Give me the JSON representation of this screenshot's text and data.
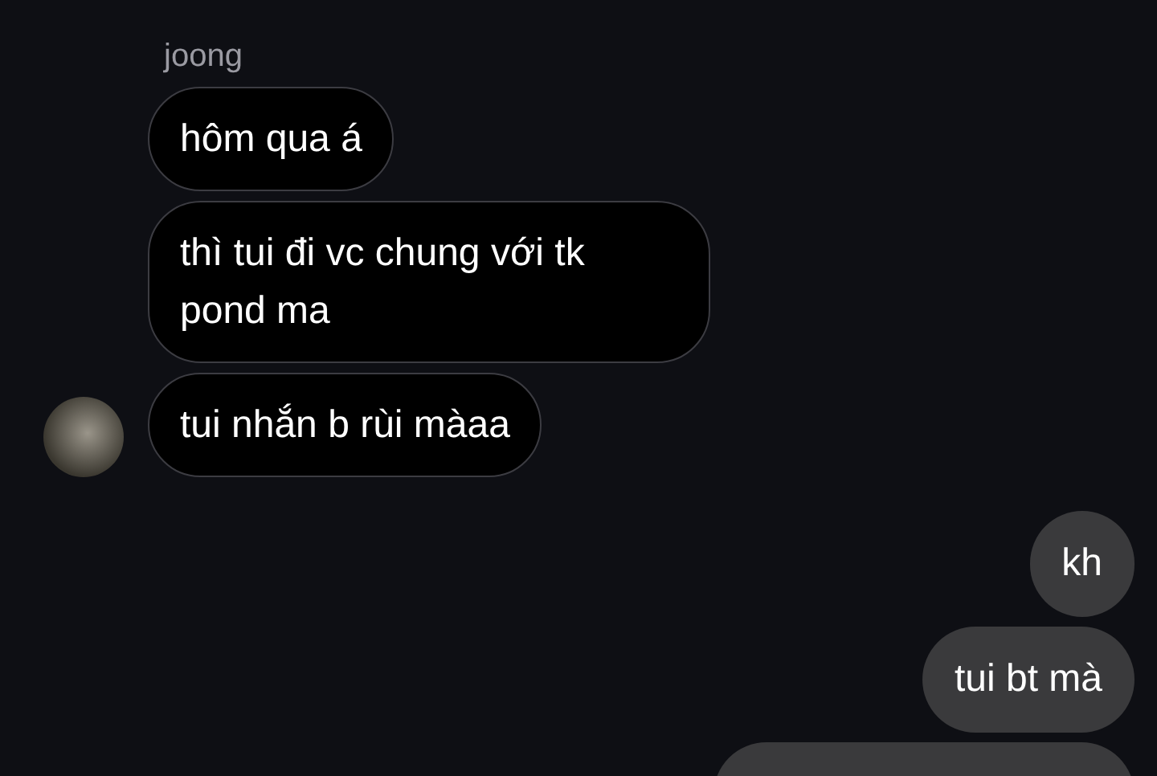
{
  "sender": {
    "name": "joong"
  },
  "messages": [
    {
      "kind": "incoming",
      "text": "hôm qua á",
      "avatar": false
    },
    {
      "kind": "incoming",
      "text": "thì tui đi vc chung với tk pond ma",
      "avatar": false
    },
    {
      "kind": "incoming",
      "text": "tui nhắn b rùi màaa",
      "avatar": true
    },
    {
      "kind": "outgoing",
      "text": "kh"
    },
    {
      "kind": "outgoing",
      "text": "tui bt mà"
    },
    {
      "kind": "cut_off"
    }
  ]
}
